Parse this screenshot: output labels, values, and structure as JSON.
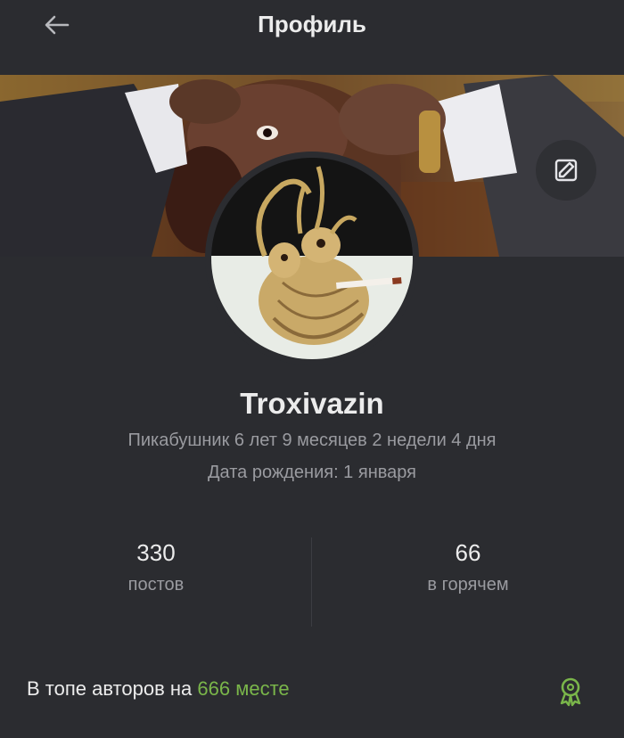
{
  "header": {
    "title": "Профиль",
    "back_icon": "arrow-left-icon"
  },
  "profile": {
    "username": "Troxivazin",
    "tenure": "Пикабушник 6 лет 9 месяцев 2 недели 4 дня",
    "birthday": "Дата рождения: 1 января",
    "edit_icon": "edit-icon"
  },
  "stats": [
    {
      "value": "330",
      "label": "постов"
    },
    {
      "value": "66",
      "label": "в горячем"
    }
  ],
  "top_authors": {
    "prefix": "В топе авторов на ",
    "rank": "666 месте",
    "icon": "award-icon"
  },
  "colors": {
    "background": "#2b2c30",
    "accent_green": "#7ab64a",
    "muted_text": "#9a9ba0"
  }
}
